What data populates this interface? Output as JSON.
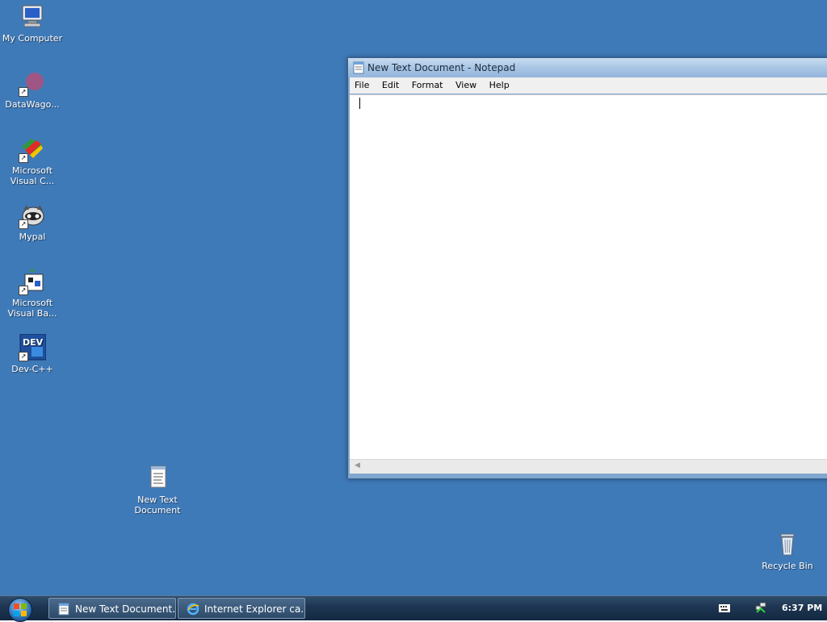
{
  "desktop": {
    "icons": [
      {
        "label": "My Computer",
        "icon": "my-computer-icon"
      },
      {
        "label": "DataWago...",
        "icon": "datawagon-icon"
      },
      {
        "label": "Microsoft Visual C...",
        "icon": "visual-c-icon"
      },
      {
        "label": "Mypal",
        "icon": "mypal-icon"
      },
      {
        "label": "Microsoft Visual Ba...",
        "icon": "visual-basic-icon"
      },
      {
        "label": "Dev-C++",
        "icon": "dev-cpp-icon",
        "badge": "DEV"
      },
      {
        "label": "New Text Document",
        "icon": "text-document-icon"
      },
      {
        "label": "Recycle Bin",
        "icon": "recycle-bin-icon"
      }
    ]
  },
  "notepad": {
    "title": "New Text Document - Notepad",
    "menu": [
      "File",
      "Edit",
      "Format",
      "View",
      "Help"
    ],
    "content": ""
  },
  "taskbar": {
    "buttons": [
      {
        "label": "New Text Document...",
        "icon": "notepad-icon"
      },
      {
        "label": "Internet Explorer ca...",
        "icon": "internet-explorer-icon"
      }
    ],
    "clock": "6:37 PM"
  },
  "colors": {
    "desktop_background": "#3f7ab8",
    "taskbar": "#1d3551",
    "window_frame": "#7fa7cf"
  }
}
